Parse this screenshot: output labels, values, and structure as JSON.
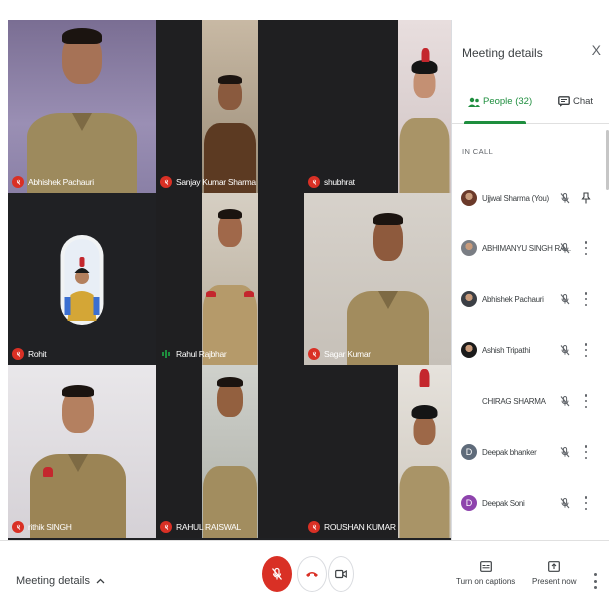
{
  "tiles": [
    {
      "name": "Abhishek Pachauri",
      "muted": true
    },
    {
      "name": "Sanjay Kumar Sharma",
      "muted": true
    },
    {
      "name": "shubhrat",
      "muted": true
    },
    {
      "name": "Rohit",
      "muted": true
    },
    {
      "name": "Rahul Rajbhar",
      "muted": false,
      "speaking": true
    },
    {
      "name": "Sagar Kumar",
      "muted": true
    },
    {
      "name": "rithik SINGH",
      "muted": true
    },
    {
      "name": "RAHUL RAISWAL",
      "muted": true
    },
    {
      "name": "ROUSHAN KUMAR",
      "muted": true
    }
  ],
  "panel": {
    "title": "Meeting details",
    "close": "X",
    "tab_people": "People (32)",
    "tab_chat": "Chat",
    "section": "IN CALL",
    "participants": [
      {
        "name": "Ujjwal Sharma (You)",
        "avatar_color": "#6b3a2a",
        "action": "pin"
      },
      {
        "name": "ABHIMANYU SINGH RA...",
        "avatar_color": "#7a7e84",
        "action": "more"
      },
      {
        "name": "Abhishek Pachauri",
        "avatar_color": "#3b3f45",
        "action": "more"
      },
      {
        "name": "Ashish Tripathi",
        "avatar_color": "#1b1b1b",
        "action": "more"
      },
      {
        "name": "CHIRAG SHARMA",
        "avatar_color": "",
        "action": "more"
      },
      {
        "name": "Deepak bhanker",
        "avatar_letter": "D",
        "avatar_color": "#5f6b7a",
        "action": "more"
      },
      {
        "name": "Deepak Soni",
        "avatar_letter": "D",
        "avatar_color": "#8e44ad",
        "action": "more"
      }
    ]
  },
  "bottom": {
    "meeting_details": "Meeting details",
    "captions": "Turn on captions",
    "present": "Present now"
  },
  "colors": {
    "accent_green": "#1e8e3e",
    "mic_off_red": "#d93025"
  }
}
